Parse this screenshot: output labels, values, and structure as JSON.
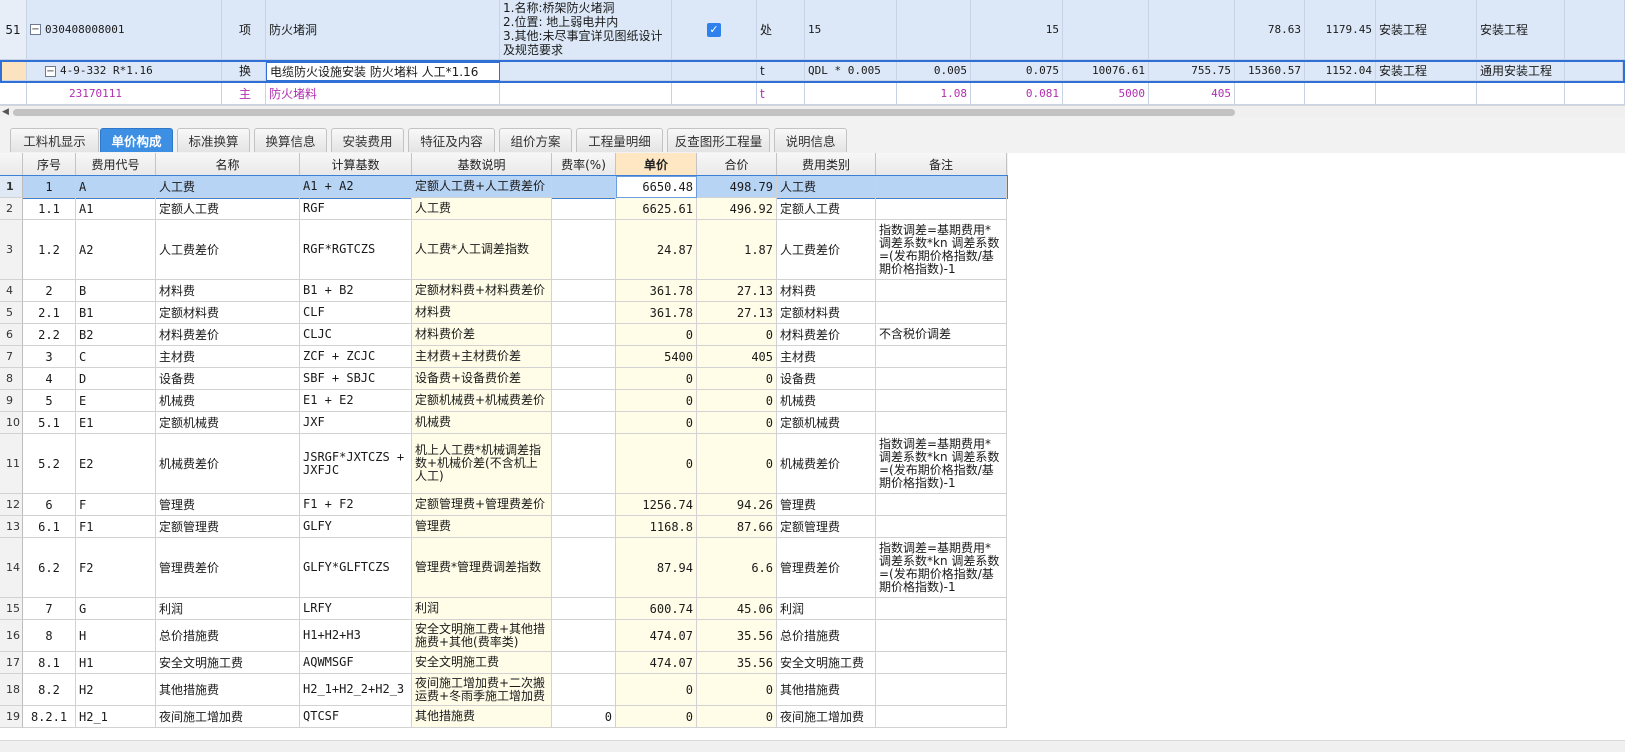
{
  "top_grid": {
    "row51": {
      "row_number": "51",
      "code": "030408008001",
      "type": "项",
      "name": "防火堵洞",
      "features": [
        "1.名称:桥架防火堵洞",
        "2.位置: 地上弱电井内",
        "3.其他:未尽事宜详见图纸设计",
        "及规范要求"
      ],
      "checked": true,
      "unit": "处",
      "qty_expr": "15",
      "qty": "15",
      "unit_price": "78.63",
      "total": "1179.45",
      "profession": "安装工程",
      "category": "安装工程"
    },
    "selected_row": {
      "code": "4-9-332 R*1.16",
      "type": "换",
      "name": "电缆防火设施安装 防火堵料  人工*1.16",
      "unit": "t",
      "qty_expr": "QDL * 0.005",
      "content": "0.005",
      "qty": "0.075",
      "price": "10076.61",
      "sub_total": "755.75",
      "unit_price": "15360.57",
      "total": "1152.04",
      "profession": "安装工程",
      "category": "通用安装工程"
    },
    "sub_row": {
      "code": "23170111",
      "type": "主",
      "name": "防火堵料",
      "unit": "t",
      "content": "1.08",
      "qty": "0.081",
      "price": "5000",
      "sub_total": "405"
    }
  },
  "tabs": [
    {
      "label": "工料机显示",
      "active": false
    },
    {
      "label": "单价构成",
      "active": true
    },
    {
      "label": "标准换算",
      "active": false
    },
    {
      "label": "换算信息",
      "active": false
    },
    {
      "label": "安装费用",
      "active": false
    },
    {
      "label": "特征及内容",
      "active": false
    },
    {
      "label": "组价方案",
      "active": false
    },
    {
      "label": "工程量明细",
      "active": false
    },
    {
      "label": "反查图形工程量",
      "active": false
    },
    {
      "label": "说明信息",
      "active": false
    }
  ],
  "detail": {
    "headers": [
      "序号",
      "费用代号",
      "名称",
      "计算基数",
      "基数说明",
      "费率(%)",
      "单价",
      "合价",
      "费用类别",
      "备注"
    ],
    "rows": [
      {
        "rn": "1",
        "seq": "1",
        "code": "A",
        "name": "人工费",
        "base": "A1 + A2",
        "desc": "定额人工费+人工费差价",
        "rate": "",
        "price": "6650.48",
        "sum": "498.79",
        "cat": "人工费",
        "note": ""
      },
      {
        "rn": "2",
        "seq": "1.1",
        "code": "A1",
        "name": "定额人工费",
        "base": "RGF",
        "desc": "人工费",
        "rate": "",
        "price": "6625.61",
        "sum": "496.92",
        "cat": "定额人工费",
        "note": ""
      },
      {
        "rn": "3",
        "seq": "1.2",
        "code": "A2",
        "name": "人工费差价",
        "base": "RGF*RGTCZS",
        "desc": "人工费*人工调差指数",
        "rate": "",
        "price": "24.87",
        "sum": "1.87",
        "cat": "人工费差价",
        "note": "指数调差=基期费用*调差系数*kn 调差系数=(发布期价格指数/基期价格指数)-1"
      },
      {
        "rn": "4",
        "seq": "2",
        "code": "B",
        "name": "材料费",
        "base": "B1 + B2",
        "desc": "定额材料费+材料费差价",
        "rate": "",
        "price": "361.78",
        "sum": "27.13",
        "cat": "材料费",
        "note": ""
      },
      {
        "rn": "5",
        "seq": "2.1",
        "code": "B1",
        "name": "定额材料费",
        "base": "CLF",
        "desc": "材料费",
        "rate": "",
        "price": "361.78",
        "sum": "27.13",
        "cat": "定额材料费",
        "note": ""
      },
      {
        "rn": "6",
        "seq": "2.2",
        "code": "B2",
        "name": "材料费差价",
        "base": "CLJC",
        "desc": "材料费价差",
        "rate": "",
        "price": "0",
        "sum": "0",
        "cat": "材料费差价",
        "note": "不含税价调差"
      },
      {
        "rn": "7",
        "seq": "3",
        "code": "C",
        "name": "主材费",
        "base": "ZCF + ZCJC",
        "desc": "主材费+主材费价差",
        "rate": "",
        "price": "5400",
        "sum": "405",
        "cat": "主材费",
        "note": ""
      },
      {
        "rn": "8",
        "seq": "4",
        "code": "D",
        "name": "设备费",
        "base": "SBF + SBJC",
        "desc": "设备费+设备费价差",
        "rate": "",
        "price": "0",
        "sum": "0",
        "cat": "设备费",
        "note": ""
      },
      {
        "rn": "9",
        "seq": "5",
        "code": "E",
        "name": "机械费",
        "base": "E1 + E2",
        "desc": "定额机械费+机械费差价",
        "rate": "",
        "price": "0",
        "sum": "0",
        "cat": "机械费",
        "note": ""
      },
      {
        "rn": "10",
        "seq": "5.1",
        "code": "E1",
        "name": "定额机械费",
        "base": "JXF",
        "desc": "机械费",
        "rate": "",
        "price": "0",
        "sum": "0",
        "cat": "定额机械费",
        "note": ""
      },
      {
        "rn": "11",
        "seq": "5.2",
        "code": "E2",
        "name": "机械费差价",
        "base": "JSRGF*JXTCZS + JXFJC",
        "desc": "机上人工费*机械调差指数+机械价差(不含机上人工)",
        "rate": "",
        "price": "0",
        "sum": "0",
        "cat": "机械费差价",
        "note": "指数调差=基期费用*调差系数*kn  调差系数=(发布期价格指数/基期价格指数)-1"
      },
      {
        "rn": "12",
        "seq": "6",
        "code": "F",
        "name": "管理费",
        "base": "F1 + F2",
        "desc": "定额管理费+管理费差价",
        "rate": "",
        "price": "1256.74",
        "sum": "94.26",
        "cat": "管理费",
        "note": ""
      },
      {
        "rn": "13",
        "seq": "6.1",
        "code": "F1",
        "name": "定额管理费",
        "base": "GLFY",
        "desc": "管理费",
        "rate": "",
        "price": "1168.8",
        "sum": "87.66",
        "cat": "定额管理费",
        "note": ""
      },
      {
        "rn": "14",
        "seq": "6.2",
        "code": "F2",
        "name": "管理费差价",
        "base": "GLFY*GLFTCZS",
        "desc": "管理费*管理费调差指数",
        "rate": "",
        "price": "87.94",
        "sum": "6.6",
        "cat": "管理费差价",
        "note": "指数调差=基期费用*调差系数*kn 调差系数=(发布期价格指数/基期价格指数)-1"
      },
      {
        "rn": "15",
        "seq": "7",
        "code": "G",
        "name": "利润",
        "base": "LRFY",
        "desc": "利润",
        "rate": "",
        "price": "600.74",
        "sum": "45.06",
        "cat": "利润",
        "note": ""
      },
      {
        "rn": "16",
        "seq": "8",
        "code": "H",
        "name": "总价措施费",
        "base": "H1+H2+H3",
        "desc": "安全文明施工费+其他措施费+其他(费率类)",
        "rate": "",
        "price": "474.07",
        "sum": "35.56",
        "cat": "总价措施费",
        "note": ""
      },
      {
        "rn": "17",
        "seq": "8.1",
        "code": "H1",
        "name": "安全文明施工费",
        "base": "AQWMSGF",
        "desc": "安全文明施工费",
        "rate": "",
        "price": "474.07",
        "sum": "35.56",
        "cat": "安全文明施工费",
        "note": ""
      },
      {
        "rn": "18",
        "seq": "8.2",
        "code": "H2",
        "name": "其他措施费",
        "base": "H2_1+H2_2+H2_3",
        "desc": "夜间施工增加费+二次搬运费+冬雨季施工增加费",
        "rate": "",
        "price": "0",
        "sum": "0",
        "cat": "其他措施费",
        "note": ""
      },
      {
        "rn": "19",
        "seq": "8.2.1",
        "code": "H2_1",
        "name": "夜间施工增加费",
        "base": "QTCSF",
        "desc": "其他措施费",
        "rate": "0",
        "price": "0",
        "sum": "0",
        "cat": "夜间施工增加费",
        "note": ""
      }
    ]
  }
}
